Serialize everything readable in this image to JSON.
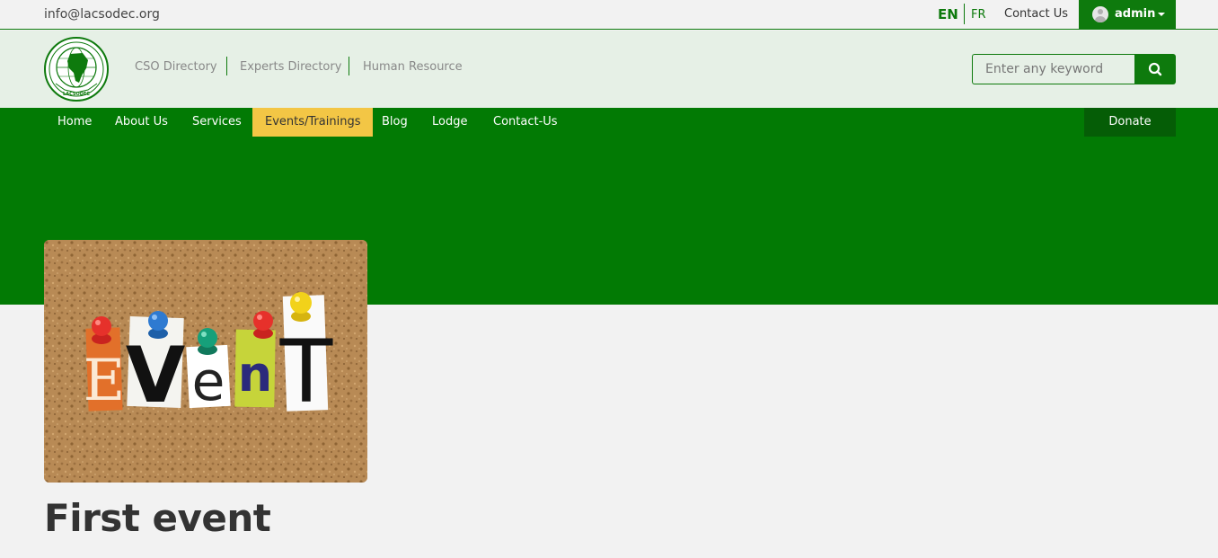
{
  "topbar": {
    "email": "info@lacsodec.org",
    "lang_en": "EN",
    "lang_fr": "FR",
    "contact": "Contact Us",
    "user": "admin"
  },
  "header": {
    "logo_text": "LACSODEC",
    "subnav": [
      "CSO Directory",
      "Experts Directory",
      "Human Resource"
    ],
    "search_placeholder": "Enter any keyword"
  },
  "mainnav": {
    "items": [
      "Home",
      "About Us",
      "Services",
      "Events/Trainings",
      "Blog",
      "Lodge",
      "Contact-Us"
    ],
    "active_index": 3,
    "donate": "Donate"
  },
  "event": {
    "image_letters": [
      "E",
      "V",
      "e",
      "n",
      "T"
    ],
    "title": "First event"
  },
  "colors": {
    "brand_green": "#027a04",
    "dark_green": "#055d06",
    "active_yellow": "#f3c645",
    "header_bg": "#e6f0e6",
    "page_bg": "#f2f2f2"
  }
}
